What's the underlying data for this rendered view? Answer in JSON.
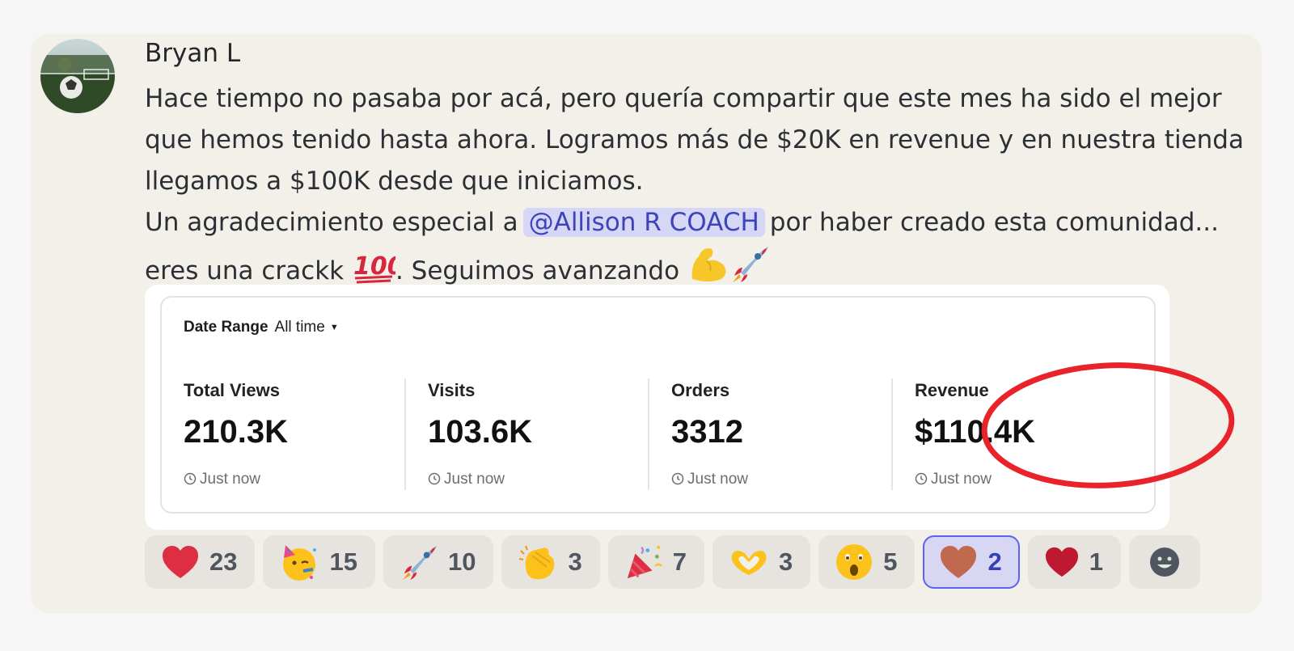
{
  "message": {
    "author": "Bryan L",
    "lines": [
      "Hace tiempo no pasaba por acá, pero quería compartir que este mes ha sido el mejor",
      "que hemos tenido hasta ahora. Logramos más de $20K en revenue y en nuestra tienda",
      "llegamos a $100K desde que iniciamos."
    ],
    "line4_before": "Un agradecimiento especial a",
    "mention": "@Allison R COACH",
    "line4_after": "por haber creado esta comunidad...",
    "line5_a": "eres una crackk",
    "line5_b": ".  Seguimos avanzando",
    "inline_emojis": [
      "hundred-points-emoji",
      "flexed-biceps-emoji",
      "rocket-emoji"
    ]
  },
  "dashboard": {
    "date_range_label": "Date Range",
    "date_range_value": "All time",
    "metrics": [
      {
        "label": "Total Views",
        "value": "210.3K",
        "time": "Just now"
      },
      {
        "label": "Visits",
        "value": "103.6K",
        "time": "Just now"
      },
      {
        "label": "Orders",
        "value": "3312",
        "time": "Just now"
      },
      {
        "label": "Revenue",
        "value": "$110.4K",
        "time": "Just now"
      }
    ],
    "annotation_color": "#e8232a"
  },
  "reactions": [
    {
      "emoji": "red-heart",
      "count": "23"
    },
    {
      "emoji": "partying-face",
      "count": "15"
    },
    {
      "emoji": "rocket",
      "count": "10"
    },
    {
      "emoji": "clapping-hands",
      "count": "3"
    },
    {
      "emoji": "party-popper",
      "count": "7"
    },
    {
      "emoji": "heart-hands",
      "count": "3"
    },
    {
      "emoji": "astonished-face",
      "count": "5"
    },
    {
      "emoji": "brown-heart",
      "count": "2",
      "active": true
    },
    {
      "emoji": "red-heart-dark",
      "count": "1"
    }
  ],
  "colors": {
    "message_bg": "#f3efe9",
    "mention_bg": "#d6d6f6",
    "mention_text": "#3c44b8",
    "active_reaction_border": "#5865f2"
  }
}
